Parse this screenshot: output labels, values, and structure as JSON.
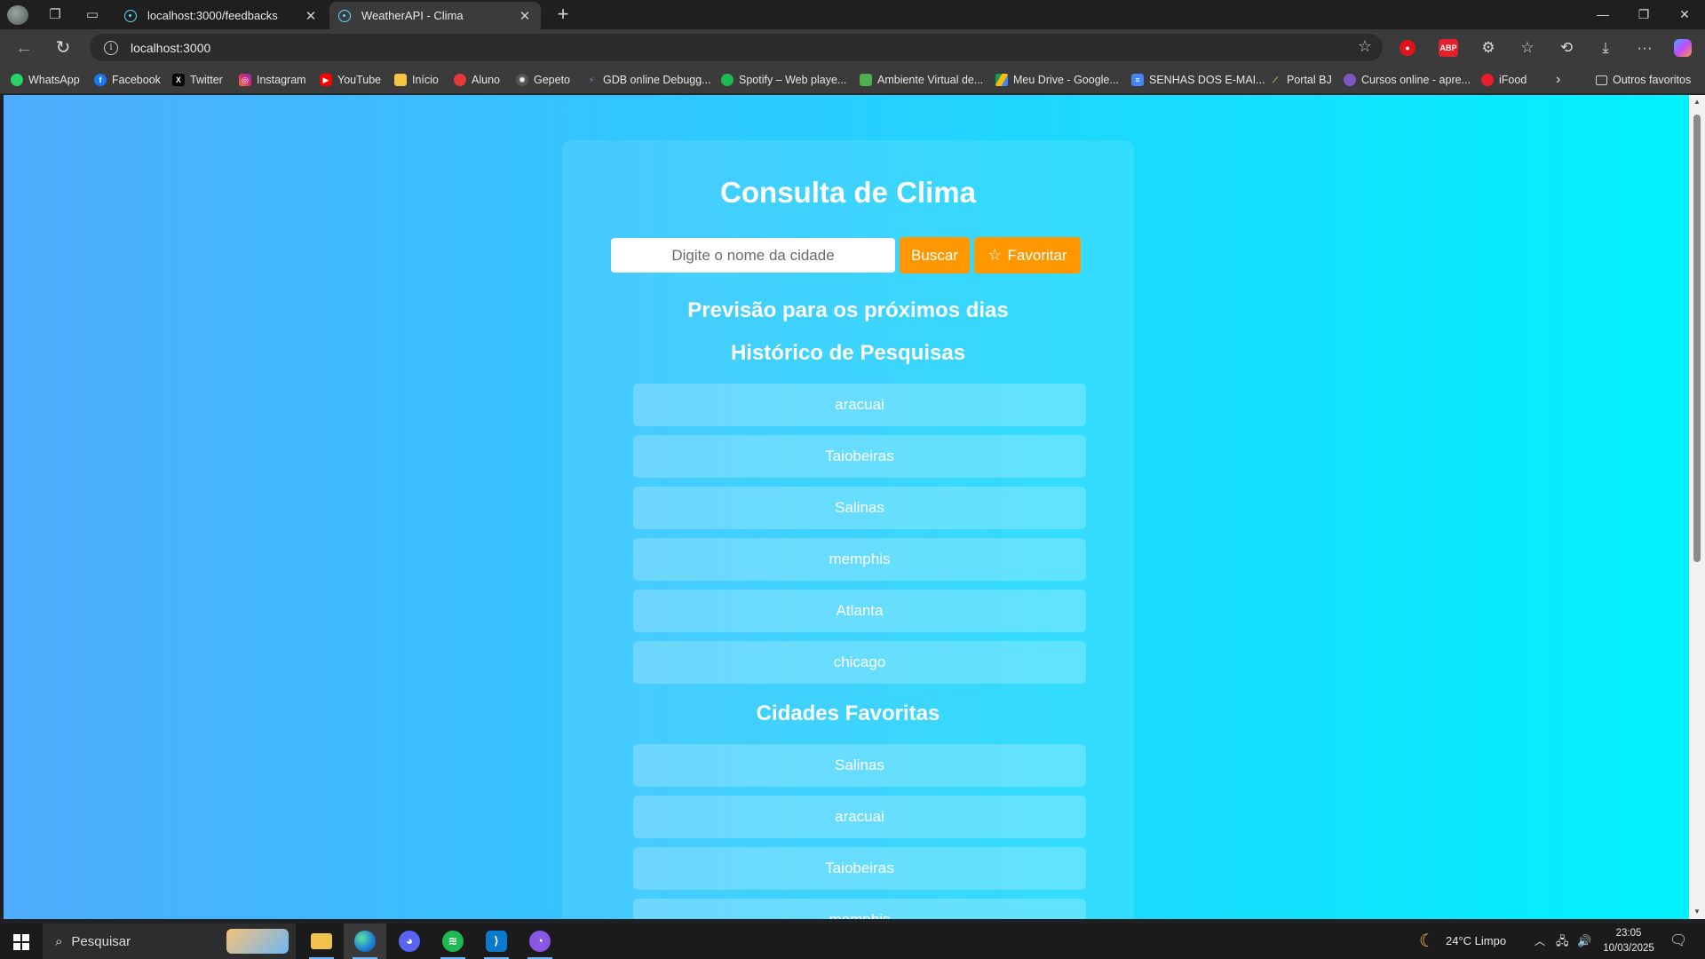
{
  "browser": {
    "tabs": [
      {
        "label": "localhost:3000/feedbacks",
        "active": false
      },
      {
        "label": "WeatherAPI - Clima",
        "active": true
      }
    ],
    "address": "localhost:3000",
    "bookmarks": [
      {
        "label": "WhatsApp",
        "icon": "whatsapp-icon",
        "color": "#25d366"
      },
      {
        "label": "Facebook",
        "icon": "facebook-icon",
        "color": "#1877f2"
      },
      {
        "label": "Twitter",
        "icon": "x-icon",
        "color": "#000000"
      },
      {
        "label": "Instagram",
        "icon": "instagram-icon",
        "color": "#e1306c"
      },
      {
        "label": "YouTube",
        "icon": "youtube-icon",
        "color": "#ff0000"
      },
      {
        "label": "Início",
        "icon": "home-icon",
        "color": "#f4c542"
      },
      {
        "label": "Aluno",
        "icon": "aluno-icon",
        "color": "#e53935"
      },
      {
        "label": "Gepeto",
        "icon": "openai-icon",
        "color": "#8e8e8e"
      },
      {
        "label": "GDB online Debugg...",
        "icon": "gdb-icon",
        "color": "#7b4dff"
      },
      {
        "label": "Spotify – Web playe...",
        "icon": "spotify-icon",
        "color": "#1db954"
      },
      {
        "label": "Ambiente Virtual de...",
        "icon": "moodle-icon",
        "color": "#4caf50"
      },
      {
        "label": "Meu Drive - Google...",
        "icon": "drive-icon",
        "color": "#fbbc04"
      },
      {
        "label": "SENHAS DOS E-MAI...",
        "icon": "docs-icon",
        "color": "#4285f4"
      },
      {
        "label": "Portal BJ",
        "icon": "portal-icon",
        "color": "#9e9d24"
      },
      {
        "label": "Cursos online - apre...",
        "icon": "courses-icon",
        "color": "#7e57c2"
      },
      {
        "label": "iFood",
        "icon": "ifood-icon",
        "color": "#ea1d2c"
      }
    ],
    "other_favorites": "Outros favoritos"
  },
  "app": {
    "title": "Consulta de Clima",
    "search": {
      "placeholder": "Digite o nome da cidade",
      "value": ""
    },
    "buscar_label": "Buscar",
    "favoritar_label": "Favoritar",
    "forecast_heading": "Previsão para os próximos dias",
    "history_heading": "Histórico de Pesquisas",
    "history": [
      "aracuai",
      "Taiobeiras",
      "Salinas",
      "memphis",
      "Atlanta",
      "chicago"
    ],
    "favorites_heading": "Cidades Favoritas",
    "favorites": [
      "Salinas",
      "aracuai",
      "Taiobeiras",
      "memphis"
    ]
  },
  "taskbar": {
    "search_placeholder": "Pesquisar",
    "weather": "24°C  Limpo",
    "time": "23:05",
    "date": "10/03/2025"
  }
}
